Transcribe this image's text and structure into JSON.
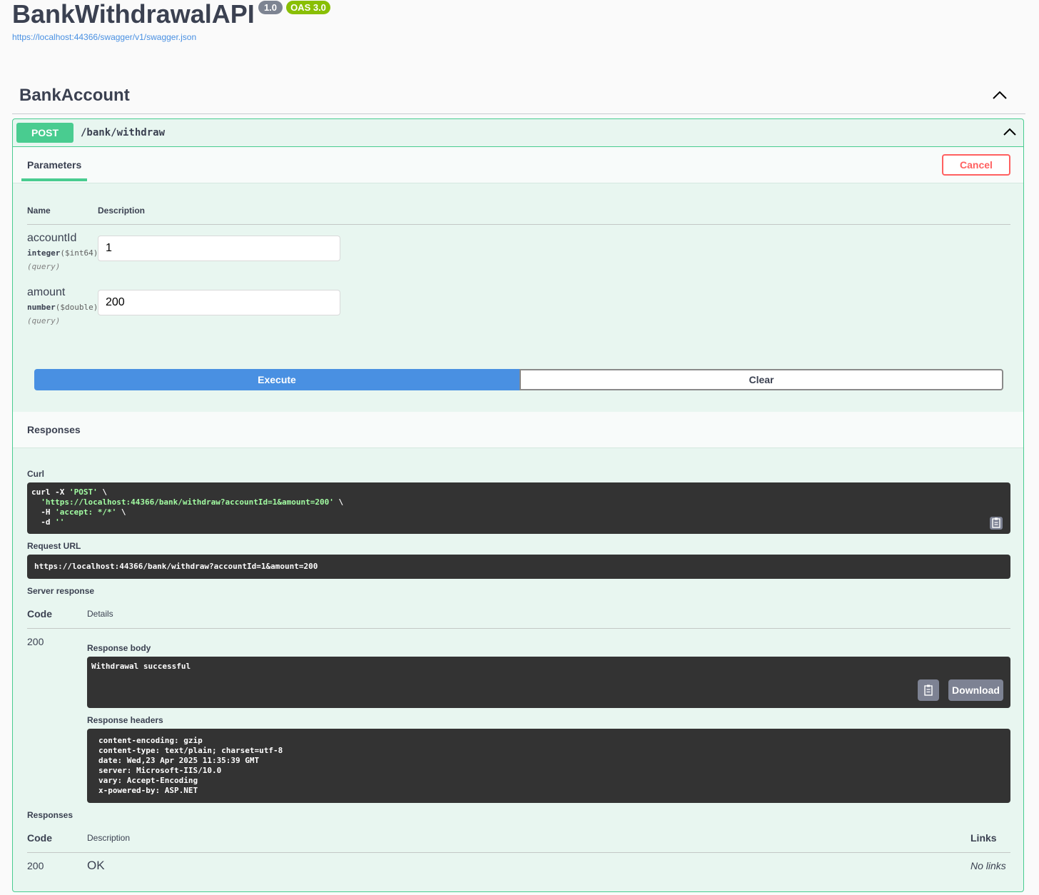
{
  "header": {
    "title": "BankWithdrawalAPI",
    "version_badge": "1.0",
    "oas_badge": "OAS 3.0",
    "spec_url": "https://localhost:44366/swagger/v1/swagger.json"
  },
  "tag": {
    "name": "BankAccount"
  },
  "operation": {
    "method": "POST",
    "path": "/bank/withdraw",
    "parameters_tab": "Parameters",
    "cancel_label": "Cancel",
    "columns": {
      "name": "Name",
      "description": "Description"
    },
    "params": [
      {
        "name": "accountId",
        "type": "integer",
        "format": "($int64)",
        "in": "(query)",
        "value": "1"
      },
      {
        "name": "amount",
        "type": "number",
        "format": "($double)",
        "in": "(query)",
        "value": "200"
      }
    ],
    "execute_label": "Execute",
    "clear_label": "Clear"
  },
  "responses_live": {
    "title": "Responses",
    "curl_label": "Curl",
    "curl": {
      "line1_cmd": "curl -X ",
      "line1_method": "'POST'",
      "line1_tail": " \\",
      "line2_url": "'https://localhost:44366/bank/withdraw?accountId=1&amount=200'",
      "line2_tail": " \\",
      "line3_flag": "-H ",
      "line3_val": "'accept: */*'",
      "line3_tail": " \\",
      "line4_flag": "-d ",
      "line4_val": "''"
    },
    "request_url_label": "Request URL",
    "request_url": "https://localhost:44366/bank/withdraw?accountId=1&amount=200",
    "server_response_label": "Server response",
    "code_col": "Code",
    "details_col": "Details",
    "code": "200",
    "response_body_label": "Response body",
    "response_body": "Withdrawal successful",
    "download_label": "Download",
    "response_headers_label": "Response headers",
    "response_headers": [
      "content-encoding: gzip",
      "content-type: text/plain; charset=utf-8",
      "date: Wed,23 Apr 2025 11:35:39 GMT",
      "server: Microsoft-IIS/10.0",
      "vary: Accept-Encoding",
      "x-powered-by: ASP.NET"
    ]
  },
  "responses_doc": {
    "title": "Responses",
    "code_col": "Code",
    "description_col": "Description",
    "links_col": "Links",
    "rows": [
      {
        "code": "200",
        "description": "OK",
        "links": "No links"
      }
    ]
  },
  "colors": {
    "post": "#49cc90",
    "execute": "#4990e2",
    "cancel": "#ff6060",
    "code_bg": "#333333",
    "string_green": "#a2fca2"
  },
  "icons": [
    "chevron-up-icon",
    "copy-to-clipboard-icon"
  ]
}
